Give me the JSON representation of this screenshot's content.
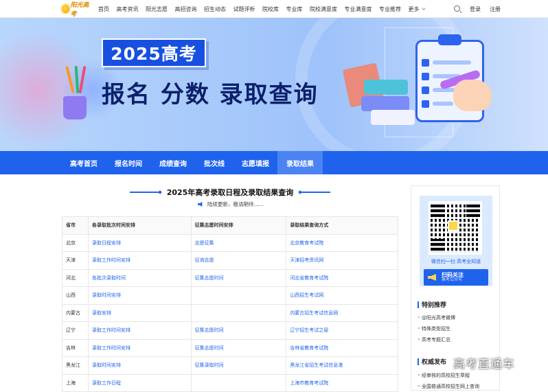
{
  "brand": {
    "logo_text": "阳光高考"
  },
  "topnav": {
    "links": [
      "首页",
      "高考资讯",
      "阳光志愿",
      "高招咨询",
      "招生动态",
      "试题评析",
      "院校库",
      "专业库",
      "院校满意度",
      "专业满意度",
      "专业推荐"
    ],
    "more": "更多",
    "login": "登录",
    "register": "注册"
  },
  "banner": {
    "tag": "2025高考",
    "headline": "报名 分数 录取查询"
  },
  "menubar": {
    "items": [
      "高考首页",
      "报名时间",
      "成绩查询",
      "批次线",
      "志愿填报",
      "录取结果"
    ],
    "active_index": 5
  },
  "main": {
    "title": "2025年高考录取日程及录取结果查询",
    "notice": "陆续更新，敬请期待......",
    "table": {
      "headers": [
        "省市",
        "各录取批次时间安排",
        "征集志愿时间安排",
        "录取结果查询方式"
      ],
      "rows": [
        [
          "北京",
          "录取日程安排",
          "志愿征集",
          "北京教育考试院"
        ],
        [
          "天津",
          "录取工作时间安排",
          "征询志愿",
          "天津招考资讯网"
        ],
        [
          "河北",
          "各批次录取时间",
          "征集志愿时间",
          "河北省教育考试院"
        ],
        [
          "山西",
          "录取时间安排",
          "",
          "山西招生考试网"
        ],
        [
          "内蒙古",
          "录取安排",
          "",
          "内蒙古招生考试信息网"
        ],
        [
          "辽宁",
          "录取工作时间安排",
          "征集志愿时间",
          "辽宁招生考试之窗"
        ],
        [
          "吉林",
          "录取工作时间安排",
          "征集志愿时间",
          "吉林省教育考试院"
        ],
        [
          "黑龙江",
          "录取时间安排",
          "征集录取时间",
          "黑龙江省招生考试信息港"
        ],
        [
          "上海",
          "录取工作日程",
          "",
          "上海市教育考试院"
        ]
      ]
    }
  },
  "sidebar": {
    "qr_caption": "微信扫一扫  高考全知道",
    "scan_title": "扫码关注",
    "scan_sub": "高考公众号",
    "section1": {
      "title": "特别推荐",
      "items": [
        "@阳光高考微博",
        "特殊类型招生",
        "高考专题汇总"
      ]
    },
    "section2": {
      "title": "权威发布",
      "items": [
        "经审核的高校招生章程",
        "全国普通高校招生网上查询"
      ]
    }
  },
  "watermark": "高考直通车",
  "colors": {
    "primary": "#1f63ed",
    "navy": "#0b1f6b",
    "banner_bg": "#a9cbfb"
  }
}
